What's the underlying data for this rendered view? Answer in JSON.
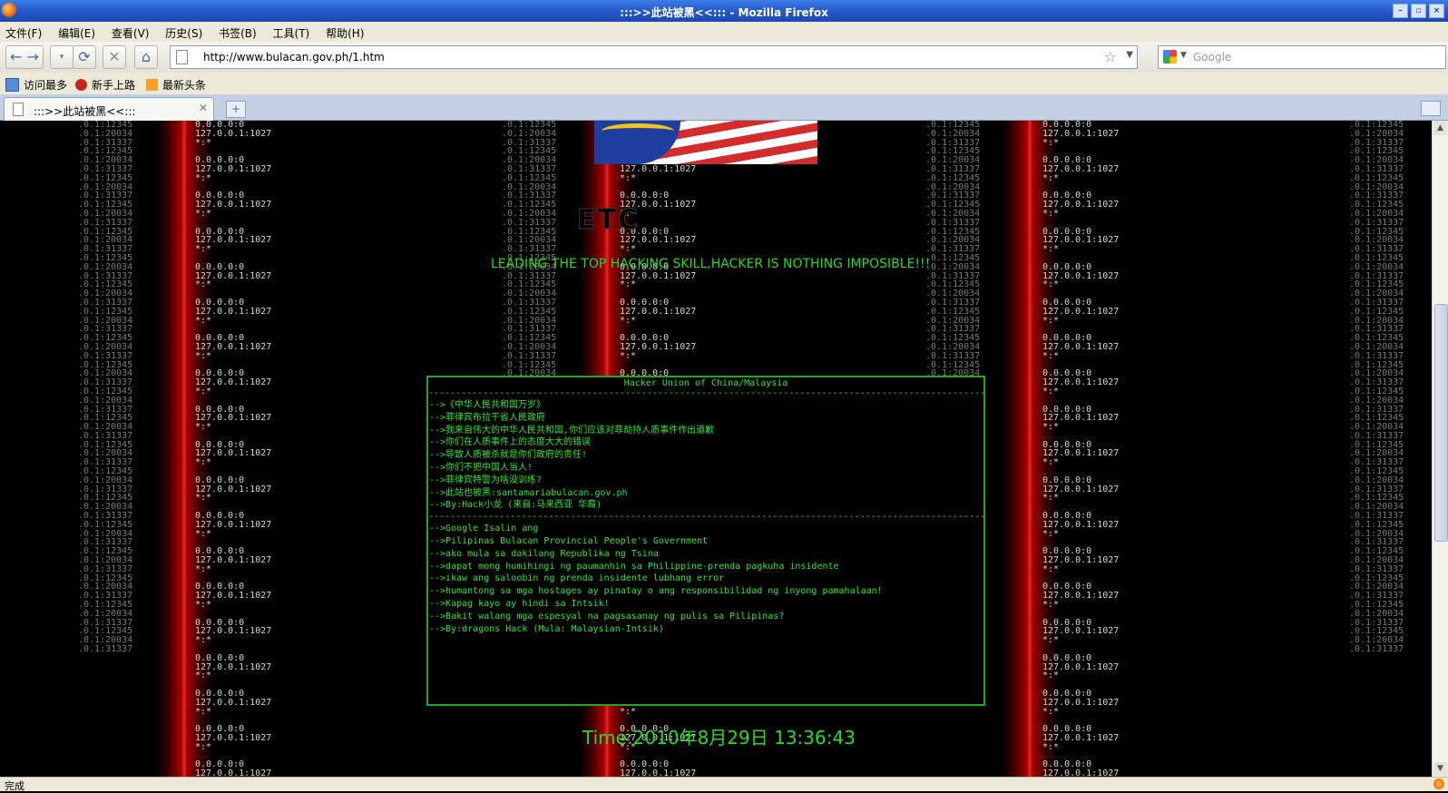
{
  "window": {
    "title": ":::>>此站被黑<<::: - Mozilla Firefox",
    "buttons": [
      "–",
      "▫",
      "×"
    ]
  },
  "menu": [
    "文件(F)",
    "编辑(E)",
    "查看(V)",
    "历史(S)",
    "书签(B)",
    "工具(T)",
    "帮助(H)"
  ],
  "nav": {
    "url": "http://www.bulacan.gov.ph/1.htm",
    "search_placeholder": "Google"
  },
  "bookmarks": [
    {
      "label": "访问最多",
      "icon": "folder-icon"
    },
    {
      "label": "新手上路",
      "icon": "firefox-icon"
    },
    {
      "label": "最新头条",
      "icon": "rss-icon"
    }
  ],
  "tab": {
    "title": ":::>>此站被黑<<:::"
  },
  "page": {
    "etc_text": "ETC",
    "slogan": "LEADING THE TOP HACKING SKILL,HACKER IS NOTHING IMPOSIBLE!!!",
    "box_title": "Hacker Union of China/Malaysia",
    "sep": "---------------------------------------------------------------------------------------------------------------------",
    "chinese_lines": [
      "-->《中华人民共和国万岁》",
      "-->菲律宾布拉干省人民政府",
      "-->我来自伟大的中华人民共和国,你们应该对菲劫持人质事件作出道歉",
      "-->你们在人质事件上的态度大大的错误",
      "-->导致人质被杀就是你们政府的责任!",
      "-->你们不把中国人当人!",
      "-->菲律宾特警为啥没训练?",
      "-->此站也被黑:santamariabulacan.gov.ph",
      "-->By:Hack小龙 (来自:马来西亚 华裔)"
    ],
    "tagalog_lines": [
      "-->Google Isalin ang",
      "-->Pilipinas Bulacan Provincial People's Government",
      "-->ako mula sa dakilang Republika ng Tsina",
      "-->dapat mong humihingi ng paumanhin sa Philippine-prenda pagkuha insidente",
      "-->ikaw ang saloobin ng prenda insidente lubhang error",
      "-->humantong sa mga hostages ay pinatay o ang responsibilidad ng inyong pamahalaan!",
      "-->Kapag kayo ay hindi sa Intsik!",
      "-->Bakit walang mga espesyal na pagsasanay ng pulis sa Pilipinas?",
      "-->By:dragons Hack (Mula: Malaysian-Intsik)"
    ],
    "time": "Time:2010年8月29日 13:36:43"
  },
  "status": "完成",
  "colors": {
    "accent_green": "#22dd22",
    "red_stripe": "#ff2a2a"
  }
}
